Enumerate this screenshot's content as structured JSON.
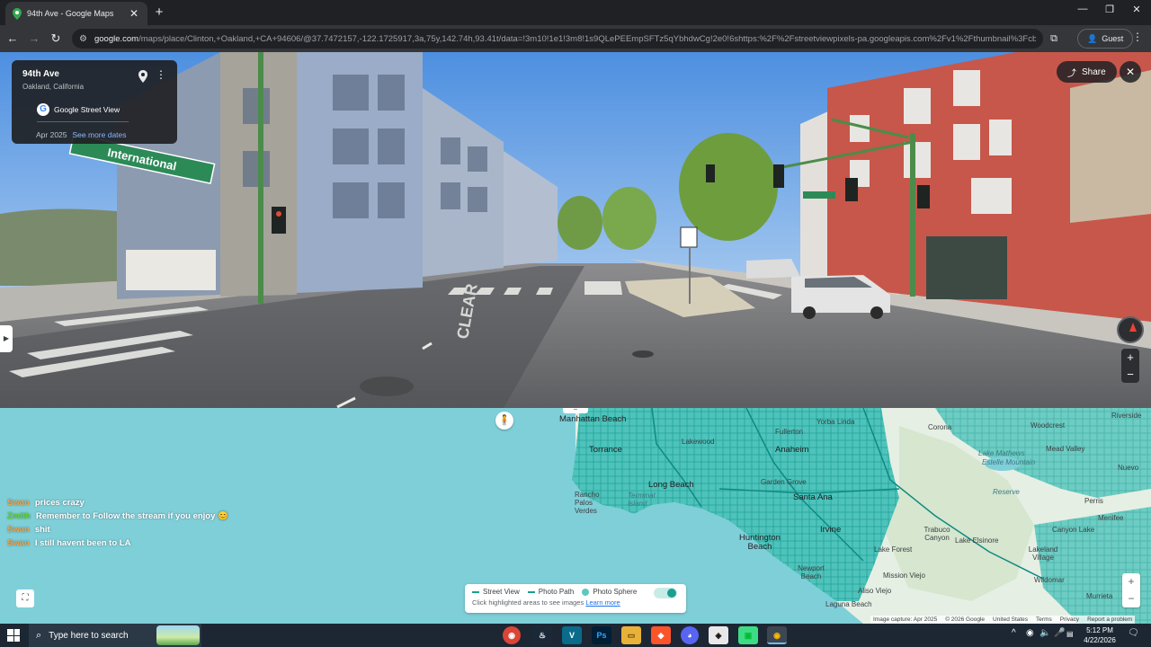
{
  "browser": {
    "tab_title": "94th Ave - Google Maps",
    "tab_close": "✕",
    "new_tab": "+",
    "window_controls": [
      "—",
      "❐",
      "✕"
    ],
    "back": "←",
    "forward": "→",
    "reload": "↻",
    "url_host": "google.com",
    "url_path": "/maps/place/Clinton,+Oakland,+CA+94606/@37.7472157,-122.1725917,3a,75y,142.74h,93.41t/data=!3m10!1e1!3m8!1s9QLePEEmpSFTz5qYbhdwCg!2e0!6shttps:%2F%2Fstreetviewpixels-pa.googleapis.com%2Fv1%2Fthumbnail%3Fcb_clien...",
    "guest_label": "Guest",
    "menu": "⋮"
  },
  "streetview": {
    "location_title": "94th Ave",
    "location_subtitle": "Oakland, California",
    "menu": "⋮",
    "source_label": "Google Street View",
    "date": "Apr 2025",
    "more_dates_link": "See more dates",
    "share_label": "Share",
    "close": "✕",
    "zoom_in": "+",
    "zoom_out": "−",
    "side_toggle": "▶",
    "street_sign": "International",
    "road_marking": "CLEAR"
  },
  "map": {
    "labels": [
      {
        "text": "Manhattan Beach",
        "kind": "city"
      },
      {
        "text": "Torrance",
        "kind": "city"
      },
      {
        "text": "Lakewood",
        "kind": "city"
      },
      {
        "text": "Fullerton",
        "kind": "city"
      },
      {
        "text": "Yorba Linda",
        "kind": "city"
      },
      {
        "text": "Corona",
        "kind": "city"
      },
      {
        "text": "Woodcrest",
        "kind": "city"
      },
      {
        "text": "Riverside",
        "kind": "city"
      },
      {
        "text": "Mead Valley",
        "kind": "city"
      },
      {
        "text": "Anaheim",
        "kind": "city"
      },
      {
        "text": "Lake Mathews",
        "kind": "water"
      },
      {
        "text": "Estelle Mountain",
        "kind": "water"
      },
      {
        "text": "Reserve",
        "kind": "water"
      },
      {
        "text": "Nuevo",
        "kind": "city"
      },
      {
        "text": "Long Beach",
        "kind": "city"
      },
      {
        "text": "Garden Grove",
        "kind": "city"
      },
      {
        "text": "Santa Ana",
        "kind": "city"
      },
      {
        "text": "Perris",
        "kind": "city"
      },
      {
        "text": "Rancho Palos Verdes",
        "kind": "city"
      },
      {
        "text": "Terminal Island",
        "kind": "city"
      },
      {
        "text": "Irvine",
        "kind": "city"
      },
      {
        "text": "Trabuco Canyon",
        "kind": "city"
      },
      {
        "text": "Canyon Lake",
        "kind": "city"
      },
      {
        "text": "Menifee",
        "kind": "city"
      },
      {
        "text": "Huntington Beach",
        "kind": "city"
      },
      {
        "text": "Lake Elsinore",
        "kind": "city"
      },
      {
        "text": "Lake Forest",
        "kind": "city"
      },
      {
        "text": "Lakeland Village",
        "kind": "city"
      },
      {
        "text": "Newport Beach",
        "kind": "city"
      },
      {
        "text": "Mission Viejo",
        "kind": "city"
      },
      {
        "text": "Aliso Viejo",
        "kind": "city"
      },
      {
        "text": "Murrieta",
        "kind": "city"
      },
      {
        "text": "Laguna Beach",
        "kind": "city"
      },
      {
        "text": "Wildomar",
        "kind": "city"
      }
    ],
    "chat": [
      {
        "user": "Swan",
        "message": "prices crazy",
        "color": "#f0a24a"
      },
      {
        "user": "Zmith",
        "message": "Remember to Follow the stream if you enjoy 😊",
        "color": "#5dd62c"
      },
      {
        "user": "Swan",
        "message": "shit",
        "color": "#f0a24a"
      },
      {
        "user": "Swan",
        "message": "I still havent been to LA",
        "color": "#f0a24a"
      }
    ],
    "legend": {
      "street_view": "Street View",
      "photo_path": "Photo Path",
      "photo_sphere": "Photo Sphere",
      "hint": "Click highlighted areas to see images",
      "learn_more": "Learn more"
    },
    "zoom_in": "+",
    "zoom_out": "−",
    "expand": "⛶",
    "pegman": "🧍",
    "handle": "=",
    "attribution": [
      "Image capture: Apr 2025",
      "© 2026 Google",
      "United States",
      "Terms",
      "Privacy",
      "Report a problem"
    ],
    "colors": {
      "water": "#7fcfd9",
      "land": "#e6efe4",
      "coverage": "#1fb5ae"
    }
  },
  "taskbar": {
    "search_placeholder": "Type here to search",
    "apps": [
      "chrome-icon",
      "steam-icon",
      "visual-icon",
      "photoshop-icon",
      "file-explorer-icon",
      "brave-icon",
      "discord-icon",
      "app-icon",
      "android-icon",
      "chrome-icon"
    ],
    "app_glyphs": [
      "◉",
      "♨",
      "V",
      "Ps",
      "▭",
      "◆",
      "◕",
      "◈",
      "▣",
      "◉"
    ],
    "tray": [
      "^",
      "◉",
      "🔈",
      "🎤",
      "▤",
      "📶"
    ],
    "time": "5:12 PM",
    "date": "4/22/2026",
    "notifications": "🗨"
  }
}
